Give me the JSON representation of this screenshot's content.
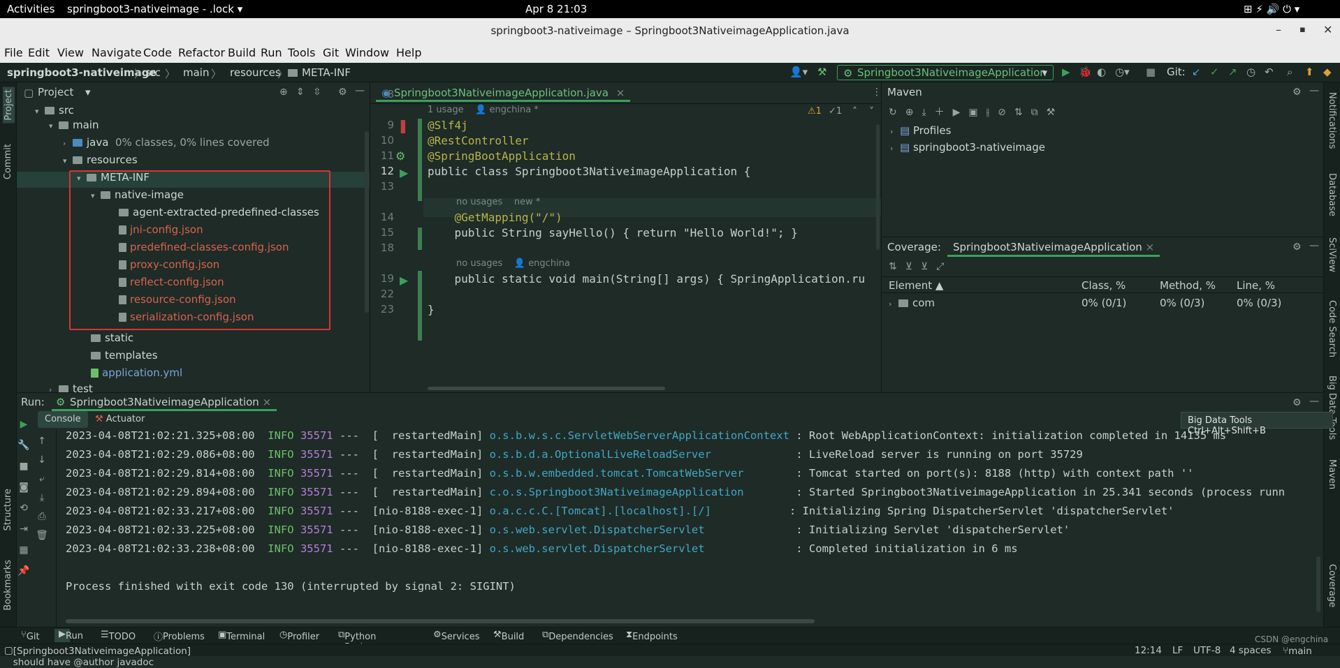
{
  "gnome": {
    "activities": "Activities",
    "app": "springboot3-nativeimage - .lock",
    "clock": "Apr 8  21:03"
  },
  "window": {
    "title": "springboot3-nativeimage – Springboot3NativeimageApplication.java"
  },
  "menu": [
    "File",
    "Edit",
    "View",
    "Navigate",
    "Code",
    "Refactor",
    "Build",
    "Run",
    "Tools",
    "Git",
    "Window",
    "Help"
  ],
  "breadcrumb": [
    "springboot3-nativeimage",
    "src",
    "main",
    "resources",
    "META-INF"
  ],
  "toolbar": {
    "run_config": "Springboot3NativeimageApplication",
    "git": "Git:"
  },
  "left_strip": {
    "project": "Project",
    "commit": "Commit",
    "structure": "Structure",
    "bookmarks": "Bookmarks"
  },
  "right_strip": {
    "notifications": "Notifications",
    "database": "Database",
    "sciview": "SciView",
    "code_search": "Code Search",
    "big_data": "Big Data Tools",
    "maven": "Maven",
    "coverage": "Coverage"
  },
  "project": {
    "title": "Project",
    "tree": [
      {
        "label": "src",
        "type": "folder"
      },
      {
        "label": "main",
        "type": "folder"
      },
      {
        "label": "java",
        "note": "0% classes, 0% lines covered",
        "type": "folder"
      },
      {
        "label": "resources",
        "type": "folder"
      },
      {
        "label": "META-INF",
        "type": "folder"
      },
      {
        "label": "native-image",
        "type": "folder"
      },
      {
        "label": "agent-extracted-predefined-classes",
        "type": "folder"
      },
      {
        "label": "jni-config.json",
        "type": "file"
      },
      {
        "label": "predefined-classes-config.json",
        "type": "file"
      },
      {
        "label": "proxy-config.json",
        "type": "file"
      },
      {
        "label": "reflect-config.json",
        "type": "file"
      },
      {
        "label": "resource-config.json",
        "type": "file"
      },
      {
        "label": "serialization-config.json",
        "type": "file"
      },
      {
        "label": "static",
        "type": "folder"
      },
      {
        "label": "templates",
        "type": "folder"
      },
      {
        "label": "application.yml",
        "type": "file"
      },
      {
        "label": "test",
        "type": "folder"
      }
    ]
  },
  "editor": {
    "tab": "Springboot3NativeimageApplication.java",
    "warnings": "1",
    "checks": "1",
    "lines": [
      {
        "n": "8",
        "text": ""
      },
      {
        "n": "9",
        "text": "@Slf4j"
      },
      {
        "n": "10",
        "text": "@RestController"
      },
      {
        "n": "11",
        "text": "@SpringBootApplication"
      },
      {
        "n": "12",
        "text": "public class Springboot3NativeimageApplication {"
      },
      {
        "n": "13",
        "text": ""
      },
      {
        "n": "14",
        "text": "    @GetMapping(\"/\")"
      },
      {
        "n": "15",
        "text": "    public String sayHello() { return \"Hello World!\"; }"
      },
      {
        "n": "18",
        "text": ""
      },
      {
        "n": "19",
        "text": "    public static void main(String[] args) { SpringApplication.ru"
      },
      {
        "n": "22",
        "text": ""
      },
      {
        "n": "23",
        "text": "}"
      }
    ],
    "hints": {
      "h1": "1 usage",
      "h1a": "engchina *",
      "h2": "no usages",
      "h2a": "new *",
      "h3": "no usages",
      "h3a": "engchina"
    }
  },
  "maven": {
    "title": "Maven",
    "items": [
      "Profiles",
      "springboot3-nativeimage"
    ]
  },
  "coverage": {
    "title": "Coverage:",
    "tab": "Springboot3NativeimageApplication",
    "columns": [
      "Element",
      "Class, %",
      "Method, %",
      "Line, %"
    ],
    "rows": [
      {
        "element": "com",
        "class": "0% (0/1)",
        "method": "0% (0/3)",
        "line": "0% (0/3)"
      }
    ]
  },
  "run": {
    "label": "Run:",
    "tab": "Springboot3NativeimageApplication",
    "console": "Console",
    "actuator": "Actuator",
    "logs": [
      {
        "ts": "2023-04-08T21:02:21.325+08:00",
        "lvl": "INFO",
        "pid": "35571",
        "thread": "---  [  restartedMain]",
        "cls": "o.s.b.w.s.c.ServletWebServerApplicationContext",
        "msg": ": Root WebApplicationContext: initialization completed in 14135 ms"
      },
      {
        "ts": "2023-04-08T21:02:29.086+08:00",
        "lvl": "INFO",
        "pid": "35571",
        "thread": "---  [  restartedMain]",
        "cls": "o.s.b.d.a.OptionalLiveReloadServer            ",
        "msg": ": LiveReload server is running on port 35729"
      },
      {
        "ts": "2023-04-08T21:02:29.814+08:00",
        "lvl": "INFO",
        "pid": "35571",
        "thread": "---  [  restartedMain]",
        "cls": "o.s.b.w.embedded.tomcat.TomcatWebServer       ",
        "msg": ": Tomcat started on port(s): 8188 (http) with context path ''"
      },
      {
        "ts": "2023-04-08T21:02:29.894+08:00",
        "lvl": "INFO",
        "pid": "35571",
        "thread": "---  [  restartedMain]",
        "cls": "c.o.s.Springboot3NativeimageApplication       ",
        "msg": ": Started Springboot3NativeimageApplication in 25.341 seconds (process runn"
      },
      {
        "ts": "2023-04-08T21:02:33.217+08:00",
        "lvl": "INFO",
        "pid": "35571",
        "thread": "---  [nio-8188-exec-1]",
        "cls": "o.a.c.c.C.[Tomcat].[localhost].[/]           ",
        "msg": ": Initializing Spring DispatcherServlet 'dispatcherServlet'"
      },
      {
        "ts": "2023-04-08T21:02:33.225+08:00",
        "lvl": "INFO",
        "pid": "35571",
        "thread": "---  [nio-8188-exec-1]",
        "cls": "o.s.web.servlet.DispatcherServlet             ",
        "msg": ": Initializing Servlet 'dispatcherServlet'"
      },
      {
        "ts": "2023-04-08T21:02:33.238+08:00",
        "lvl": "INFO",
        "pid": "35571",
        "thread": "---  [nio-8188-exec-1]",
        "cls": "o.s.web.servlet.DispatcherServlet             ",
        "msg": ": Completed initialization in 6 ms"
      }
    ],
    "exit": "Process finished with exit code 130 (interrupted by signal 2: SIGINT)"
  },
  "tooltip": {
    "text": "Big Data Tools  Ctrl+Alt+Shift+B"
  },
  "bottom_tabs": [
    "Git",
    "Run",
    "TODO",
    "Problems",
    "Terminal",
    "Profiler",
    "Python Packages",
    "Services",
    "Build",
    "Dependencies",
    "Endpoints"
  ],
  "status": {
    "message": "[Springboot3NativeimageApplication] should have @author javadoc",
    "pos": "12:14",
    "le": "LF",
    "enc": "UTF-8",
    "indent": "4 spaces",
    "branch": "main",
    "watermark": "CSDN @engchina"
  }
}
